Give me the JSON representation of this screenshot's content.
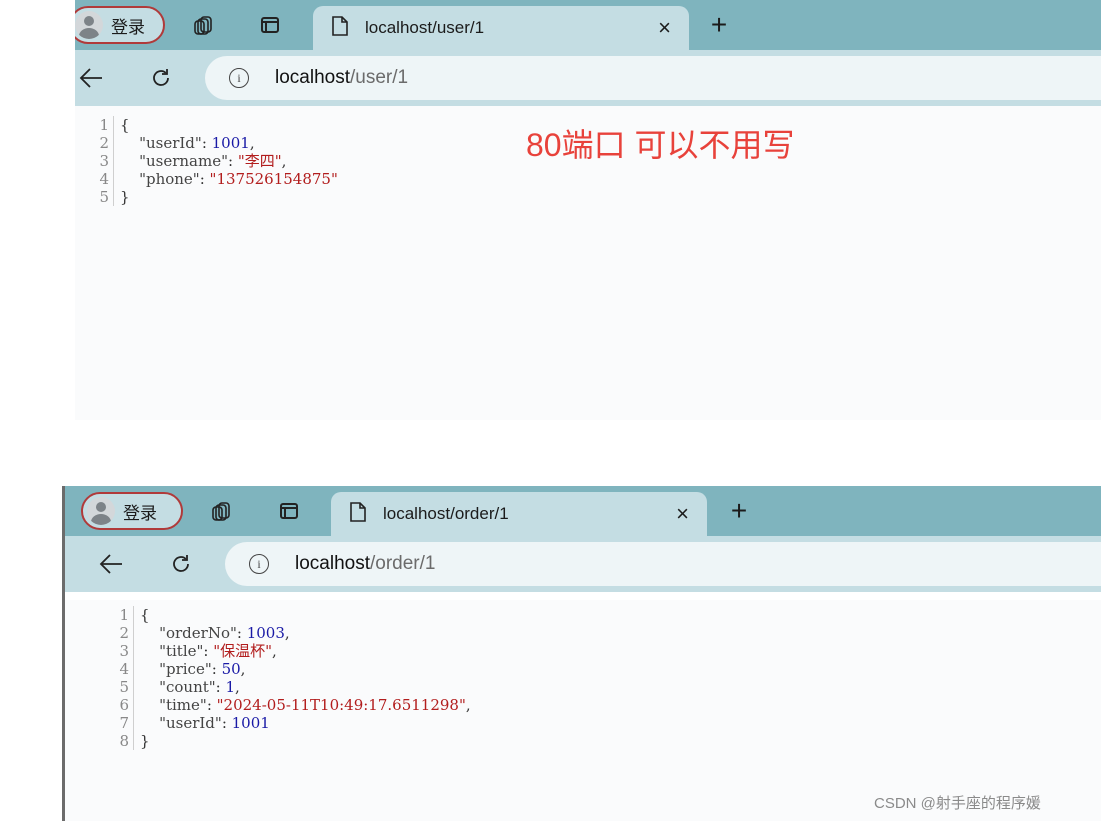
{
  "window1": {
    "profile_label": "登录",
    "tab_title": "localhost/user/1",
    "url_host": "localhost",
    "url_path": "/user/1",
    "code_lines": [
      [
        [
          "p",
          "{"
        ]
      ],
      [
        [
          "p",
          "    "
        ],
        [
          "k",
          "\"userId\""
        ],
        [
          "p",
          ": "
        ],
        [
          "n",
          "1001"
        ],
        [
          "p",
          ","
        ]
      ],
      [
        [
          "p",
          "    "
        ],
        [
          "k",
          "\"username\""
        ],
        [
          "p",
          ": "
        ],
        [
          "s",
          "\"李四\""
        ],
        [
          "p",
          ","
        ]
      ],
      [
        [
          "p",
          "    "
        ],
        [
          "k",
          "\"phone\""
        ],
        [
          "p",
          ": "
        ],
        [
          "s",
          "\"137526154875\""
        ]
      ],
      [
        [
          "p",
          "}"
        ]
      ]
    ]
  },
  "window2": {
    "profile_label": "登录",
    "tab_title": "localhost/order/1",
    "url_host": "localhost",
    "url_path": "/order/1",
    "code_lines": [
      [
        [
          "p",
          "{"
        ]
      ],
      [
        [
          "p",
          "    "
        ],
        [
          "k",
          "\"orderNo\""
        ],
        [
          "p",
          ": "
        ],
        [
          "n",
          "1003"
        ],
        [
          "p",
          ","
        ]
      ],
      [
        [
          "p",
          "    "
        ],
        [
          "k",
          "\"title\""
        ],
        [
          "p",
          ": "
        ],
        [
          "s",
          "\"保温杯\""
        ],
        [
          "p",
          ","
        ]
      ],
      [
        [
          "p",
          "    "
        ],
        [
          "k",
          "\"price\""
        ],
        [
          "p",
          ": "
        ],
        [
          "n",
          "50"
        ],
        [
          "p",
          ","
        ]
      ],
      [
        [
          "p",
          "    "
        ],
        [
          "k",
          "\"count\""
        ],
        [
          "p",
          ": "
        ],
        [
          "n",
          "1"
        ],
        [
          "p",
          ","
        ]
      ],
      [
        [
          "p",
          "    "
        ],
        [
          "k",
          "\"time\""
        ],
        [
          "p",
          ": "
        ],
        [
          "s",
          "\"2024-05-11T10:49:17.6511298\""
        ],
        [
          "p",
          ","
        ]
      ],
      [
        [
          "p",
          "    "
        ],
        [
          "k",
          "\"userId\""
        ],
        [
          "p",
          ": "
        ],
        [
          "n",
          "1001"
        ]
      ],
      [
        [
          "p",
          "}"
        ]
      ]
    ]
  },
  "annotation": "80端口  可以不用写",
  "watermark": "CSDN @射手座的程序媛",
  "colors": {
    "tabbar": "#7fb4be",
    "toolbar": "#c4dde3",
    "annotation": "#e8423b",
    "json_string": "#b21d1d",
    "json_number": "#1a1aa6"
  },
  "icons": [
    "user-avatar-icon",
    "workspaces-icon",
    "tab-actions-icon",
    "page-icon",
    "close-icon",
    "new-tab-icon",
    "back-arrow-icon",
    "reload-icon",
    "info-icon"
  ]
}
